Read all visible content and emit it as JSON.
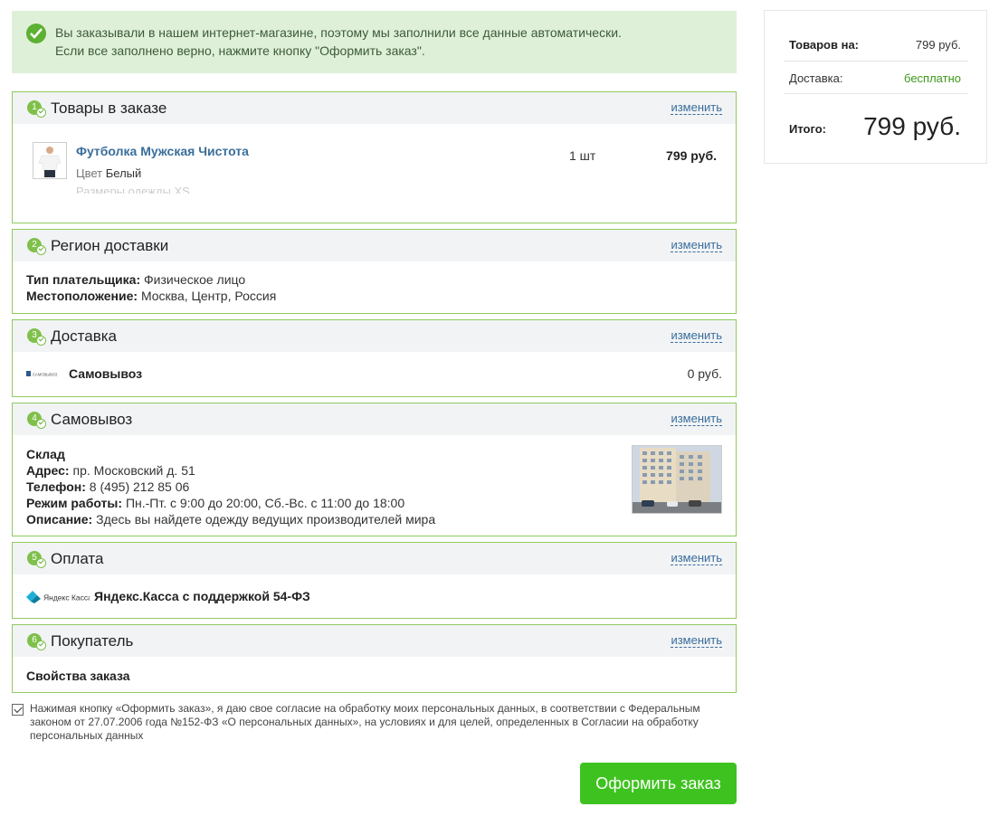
{
  "notice": {
    "line1": "Вы заказывали в нашем интернет-магазине, поэтому мы заполнили все данные автоматически.",
    "line2": "Если все заполнено верно, нажмите кнопку \"Оформить заказ\"."
  },
  "edit_label": "изменить",
  "sections": [
    {
      "num": "1",
      "title": "Товары в заказе"
    },
    {
      "num": "2",
      "title": "Регион доставки"
    },
    {
      "num": "3",
      "title": "Доставка"
    },
    {
      "num": "4",
      "title": "Самовывоз"
    },
    {
      "num": "5",
      "title": "Оплата"
    },
    {
      "num": "6",
      "title": "Покупатель"
    }
  ],
  "cart": {
    "name": "Футболка Мужская Чистота",
    "color_label": "Цвет",
    "color_value": "Белый",
    "size_label": "Размеры одежды",
    "size_value": "XS",
    "qty": "1 шт",
    "price": "799 руб."
  },
  "region": {
    "payer_label": "Тип плательщика:",
    "payer_value": "Физическое лицо",
    "location_label": "Местоположение:",
    "location_value": "Москва, Центр, Россия"
  },
  "delivery": {
    "logo_text": "САМОВЫВОЗ",
    "name": "Самовывоз",
    "price": "0 руб."
  },
  "pickup": {
    "store": "Склад",
    "address_label": "Адрес:",
    "address_value": "пр. Московский д. 51",
    "phone_label": "Телефон:",
    "phone_value": "8 (495) 212 85 06",
    "hours_label": "Режим работы:",
    "hours_value": "Пн.-Пт. с 9:00 до 20:00, Сб.-Вс. с 11:00 до 18:00",
    "desc_label": "Описание:",
    "desc_value": "Здесь вы найдете одежду ведущих производителей мира"
  },
  "payment": {
    "logo_text": "Яндекс Касса",
    "name": "Яндекс.Касса с поддержкой 54-ФЗ"
  },
  "buyer": {
    "props_label": "Свойства заказа"
  },
  "consent": {
    "checked": true,
    "text": "Нажимая кнопку «Оформить заказ», я даю свое согласие на обработку моих персональных данных, в соответствии с Федеральным законом от 27.07.2006 года №152-ФЗ «О персональных данных», на условиях и для целей, определенных в Согласии на обработку персональных данных"
  },
  "submit_label": "Оформить заказ",
  "summary": {
    "goods_label": "Товаров на:",
    "goods_value": "799 руб.",
    "delivery_label": "Доставка:",
    "delivery_value": "бесплатно",
    "total_label": "Итого:",
    "total_value": "799 руб."
  },
  "colors": {
    "accent_green": "#3ec21f",
    "border_green": "#91ca5e",
    "link_blue": "#3a6e9b",
    "notice_bg": "#dff0d8"
  }
}
